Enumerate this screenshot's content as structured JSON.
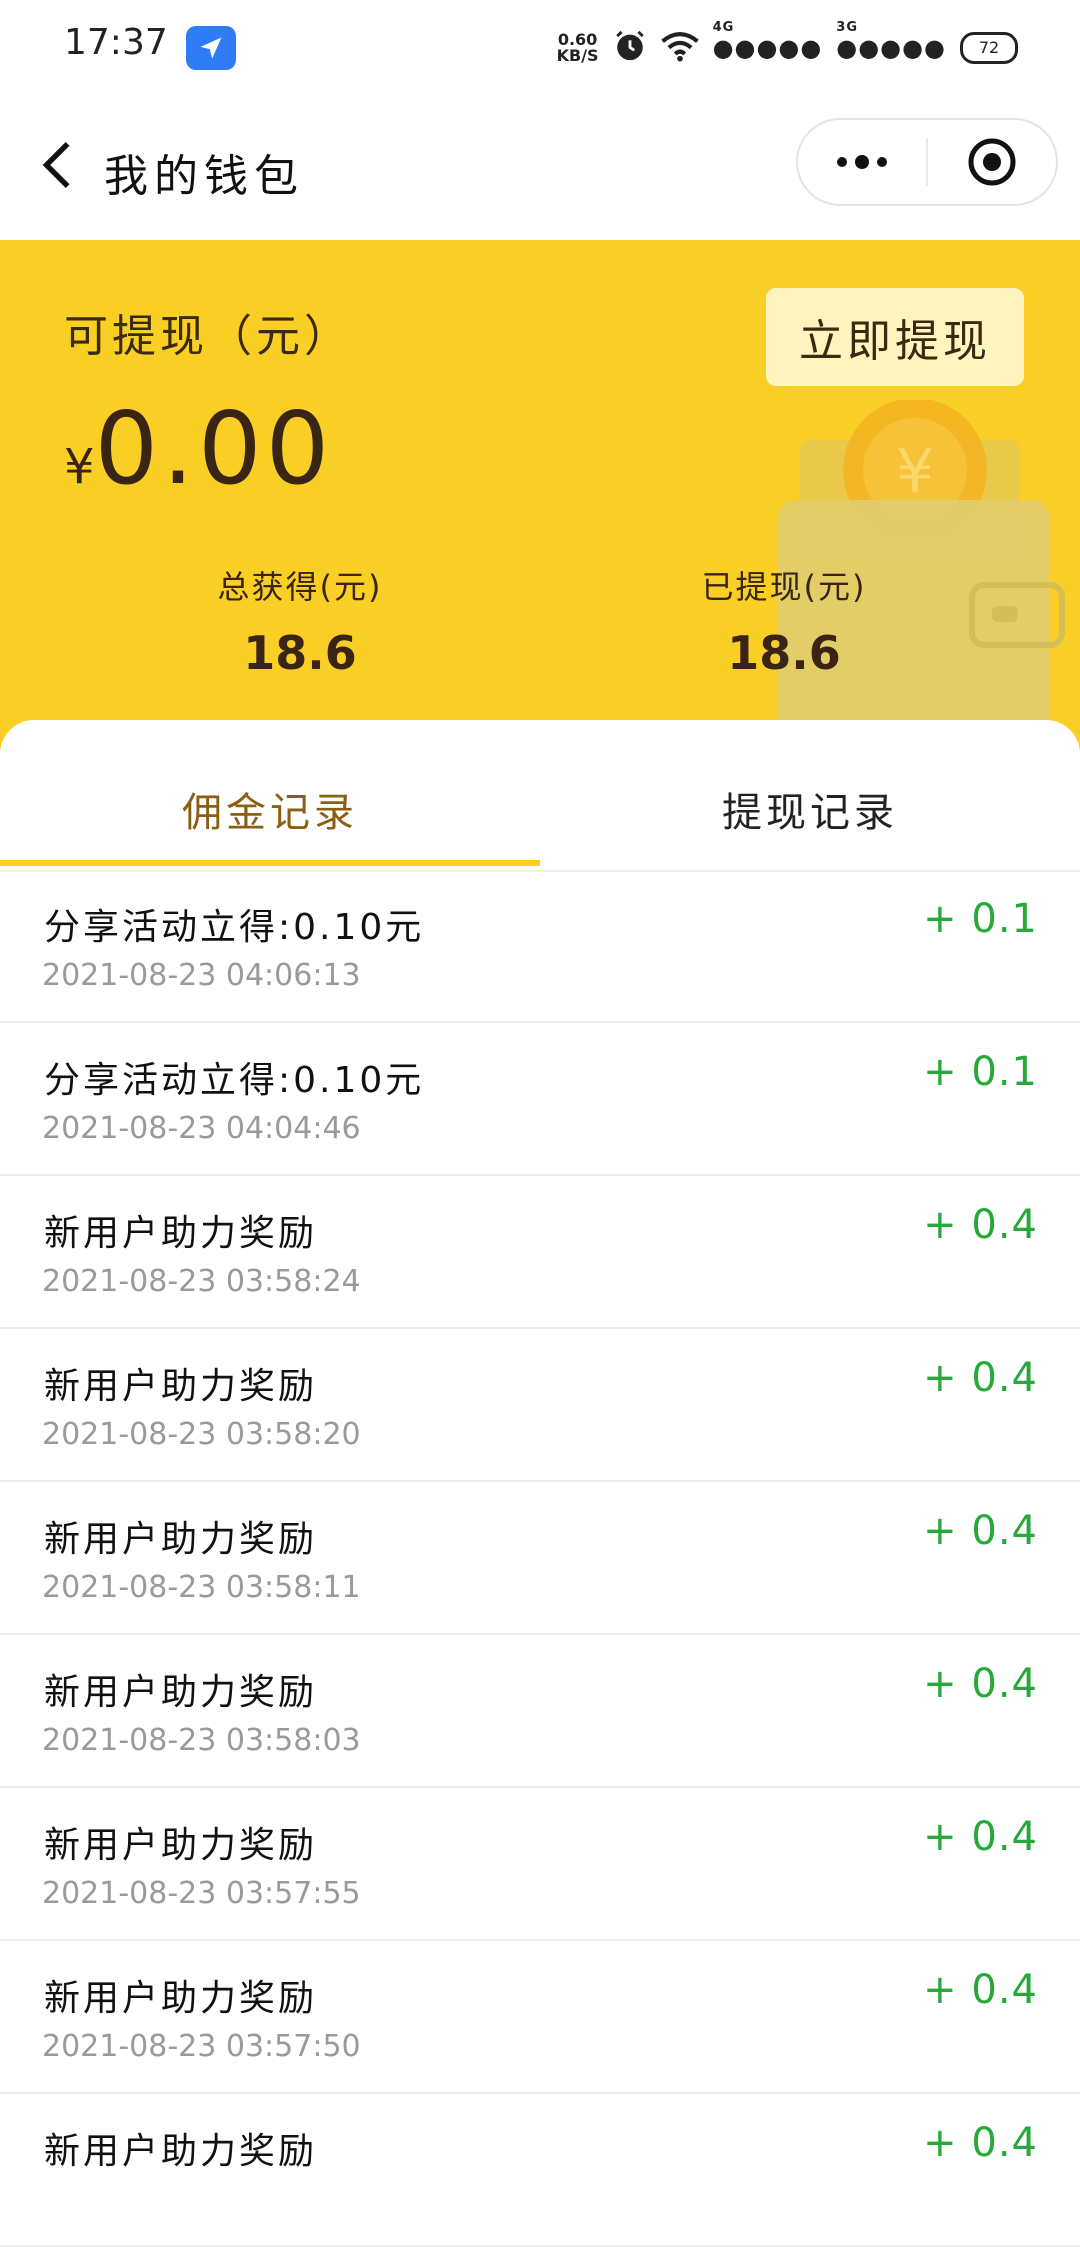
{
  "status": {
    "time": "17:37",
    "net_speed_top": "0.60",
    "net_speed_bottom": "KB/S",
    "net1": "4G",
    "net2": "3G",
    "battery": "72"
  },
  "header": {
    "title": "我的钱包"
  },
  "wallet": {
    "available_label": "可提现（元）",
    "withdraw_button": "立即提现",
    "currency_symbol": "¥",
    "available_amount": "0.00",
    "total_label": "总获得(元)",
    "total_value": "18.6",
    "withdrawn_label": "已提现(元)",
    "withdrawn_value": "18.6"
  },
  "tabs": [
    {
      "label": "佣金记录",
      "active": true
    },
    {
      "label": "提现记录",
      "active": false
    }
  ],
  "records": [
    {
      "title": "分享活动立得:0.10元",
      "time": "2021-08-23 04:06:13",
      "amount": "+ 0.1"
    },
    {
      "title": "分享活动立得:0.10元",
      "time": "2021-08-23 04:04:46",
      "amount": "+ 0.1"
    },
    {
      "title": "新用户助力奖励",
      "time": "2021-08-23 03:58:24",
      "amount": "+ 0.4"
    },
    {
      "title": "新用户助力奖励",
      "time": "2021-08-23 03:58:20",
      "amount": "+ 0.4"
    },
    {
      "title": "新用户助力奖励",
      "time": "2021-08-23 03:58:11",
      "amount": "+ 0.4"
    },
    {
      "title": "新用户助力奖励",
      "time": "2021-08-23 03:58:03",
      "amount": "+ 0.4"
    },
    {
      "title": "新用户助力奖励",
      "time": "2021-08-23 03:57:55",
      "amount": "+ 0.4"
    },
    {
      "title": "新用户助力奖励",
      "time": "2021-08-23 03:57:50",
      "amount": "+ 0.4"
    },
    {
      "title": "新用户助力奖励",
      "time": "",
      "amount": "+ 0.4"
    }
  ],
  "colors": {
    "banner": "#f9cf26",
    "accent_text": "#8a5f14",
    "positive": "#26a83a"
  }
}
